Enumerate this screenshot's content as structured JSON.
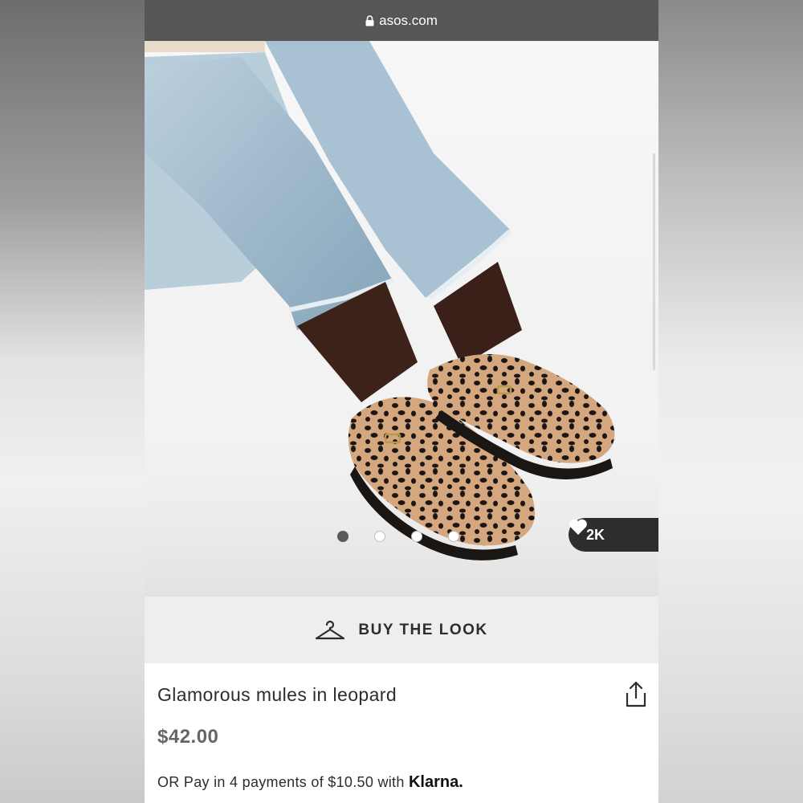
{
  "browser": {
    "url": "asos.com"
  },
  "gallery": {
    "image_count": 4,
    "active_index": 0,
    "likes": "2K"
  },
  "buy_the_look": {
    "label": "BUY THE LOOK"
  },
  "product": {
    "title": "Glamorous mules in leopard",
    "price": "$42.00",
    "payment_prefix": "OR Pay in 4 payments of $10.50 with",
    "payment_provider": "Klarna."
  },
  "icons": {
    "lock": "lock-icon",
    "heart": "heart-icon",
    "hanger": "hanger-icon",
    "share": "share-icon"
  },
  "colors": {
    "url_bar": "#575655",
    "badge": "#2d2d2d",
    "text": "#2d2d2d",
    "price": "#666666",
    "buy_bar": "#eeeeee"
  }
}
